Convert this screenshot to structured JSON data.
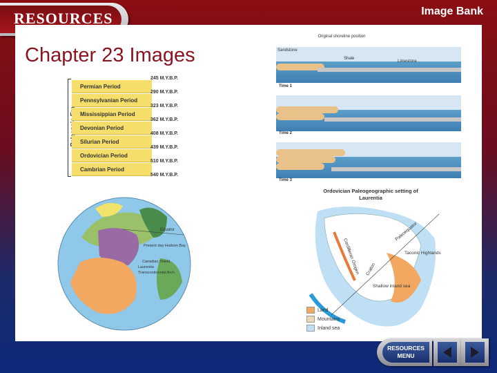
{
  "header": {
    "resources_title": "RESOURCES",
    "image_bank": "Image Bank"
  },
  "main": {
    "chapter_title": "Chapter 23 Images"
  },
  "timescale": {
    "era": "Paleozoic Era",
    "periods": [
      {
        "name": "Permian Period",
        "mya": "245 M.Y.B.P."
      },
      {
        "name": "Pennsylvanian Period",
        "mya": "290 M.Y.B.P."
      },
      {
        "name": "Mississippian Period",
        "mya": "323 M.Y.B.P."
      },
      {
        "name": "Devonian Period",
        "mya": "362 M.Y.B.P."
      },
      {
        "name": "Silurian Period",
        "mya": "408 M.Y.B.P."
      },
      {
        "name": "Ordovician Period",
        "mya": "439 M.Y.B.P."
      },
      {
        "name": "Cambrian Period",
        "mya": "510 M.Y.B.P."
      }
    ],
    "last_mya": "540 M.Y.B.P."
  },
  "shoreline": {
    "original": "Original shoreline position",
    "sandstone": "Sandstone",
    "shale": "Shale",
    "limestone": "Limestone",
    "times": [
      "Time 1",
      "Time 2",
      "Time 3"
    ]
  },
  "globe": {
    "equator": "Equator",
    "labels": [
      "Present day Hudson Bay",
      "Canadian Shield",
      "Laurentia",
      "Transcontinental Arch"
    ]
  },
  "laurentia_map": {
    "title": "Ordovician Paleogeographic setting of Laurentia",
    "labels": [
      "Cordilleran Orogen",
      "Paleoequator",
      "Taconic Highlands",
      "Craton",
      "Shallow inland sea"
    ],
    "legend": [
      "Land",
      "Mountains",
      "Inland sea"
    ]
  },
  "nav": {
    "menu_label_1": "RESOURCES",
    "menu_label_2": "MENU"
  },
  "colors": {
    "brand_red": "#8a1420",
    "nav_blue": "#1a3070"
  }
}
